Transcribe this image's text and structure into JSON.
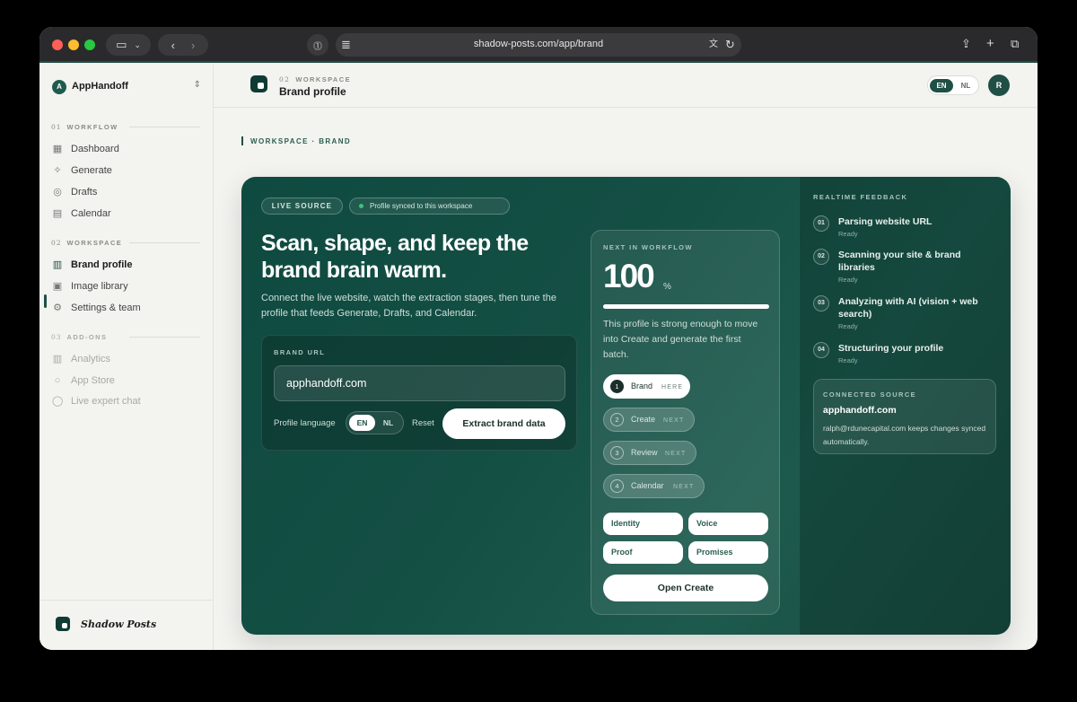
{
  "browser": {
    "url": "shadow-posts.com/app/brand"
  },
  "sidebar": {
    "org_initial": "A",
    "org_name": "AppHandoff",
    "sections": [
      {
        "num": "01",
        "label": "WORKFLOW"
      },
      {
        "num": "02",
        "label": "WORKSPACE"
      },
      {
        "num": "03",
        "label": "ADD-ONS"
      }
    ],
    "workflow_items": [
      {
        "label": "Dashboard",
        "icon": "grid-icon"
      },
      {
        "label": "Generate",
        "icon": "sparkle-icon"
      },
      {
        "label": "Drafts",
        "icon": "check-circle-icon"
      },
      {
        "label": "Calendar",
        "icon": "calendar-icon"
      }
    ],
    "workspace_items": [
      {
        "label": "Brand profile",
        "icon": "document-icon"
      },
      {
        "label": "Image library",
        "icon": "image-icon"
      },
      {
        "label": "Settings & team",
        "icon": "gear-icon"
      }
    ],
    "addon_items": [
      {
        "label": "Analytics",
        "icon": "bar-chart-icon"
      },
      {
        "label": "App Store",
        "icon": "bulb-icon"
      },
      {
        "label": "Live expert chat",
        "icon": "chat-icon"
      }
    ],
    "footer_name": "Shadow Posts"
  },
  "header": {
    "kicker_num": "02",
    "kicker": "WORKSPACE",
    "title": "Brand profile",
    "lang_en": "EN",
    "lang_nl": "NL",
    "avatar": "R"
  },
  "main": {
    "breadcrumb": "WORKSPACE · BRAND",
    "live_source": "LIVE SOURCE",
    "sync_status": "Profile synced to this workspace",
    "headline": "Scan, shape, and keep the brand brain warm.",
    "subcopy": "Connect the live website, watch the extraction stages, then tune the profile that feeds Generate, Drafts, and Calendar.",
    "brand_url_label": "BRAND URL",
    "brand_url_value": "apphandoff.com",
    "profile_language_label": "Profile language",
    "lang_en": "EN",
    "lang_nl": "NL",
    "reset_label": "Reset",
    "extract_label": "Extract brand data"
  },
  "workflow_panel": {
    "label": "NEXT IN WORKFLOW",
    "score": "100",
    "unit": "%",
    "progress": 1.0,
    "description": "This profile is strong enough to move into Create and generate the first batch.",
    "steps": [
      {
        "num": "1",
        "label": "Brand",
        "status": "HERE"
      },
      {
        "num": "2",
        "label": "Create",
        "status": "NEXT"
      },
      {
        "num": "3",
        "label": "Review",
        "status": "NEXT"
      },
      {
        "num": "4",
        "label": "Calendar",
        "status": "NEXT"
      }
    ],
    "chips": [
      "Identity",
      "Voice",
      "Proof",
      "Promises"
    ],
    "open_create_label": "Open Create"
  },
  "realtime_feedback": {
    "label": "REALTIME FEEDBACK",
    "items": [
      {
        "num": "01",
        "title": "Parsing website URL",
        "status": "Ready"
      },
      {
        "num": "02",
        "title": "Scanning your site & brand libraries",
        "status": "Ready"
      },
      {
        "num": "03",
        "title": "Analyzing with AI (vision + web search)",
        "status": "Ready"
      },
      {
        "num": "04",
        "title": "Structuring your profile",
        "status": "Ready"
      }
    ],
    "connected_label": "CONNECTED SOURCE",
    "connected_domain": "apphandoff.com",
    "connected_desc": "ralph@rdunecapital.com keeps changes synced automatically."
  },
  "colors": {
    "brand_green": "#1f4f45",
    "card_bg": "#144f44",
    "status_dot": "#3dc27a"
  }
}
